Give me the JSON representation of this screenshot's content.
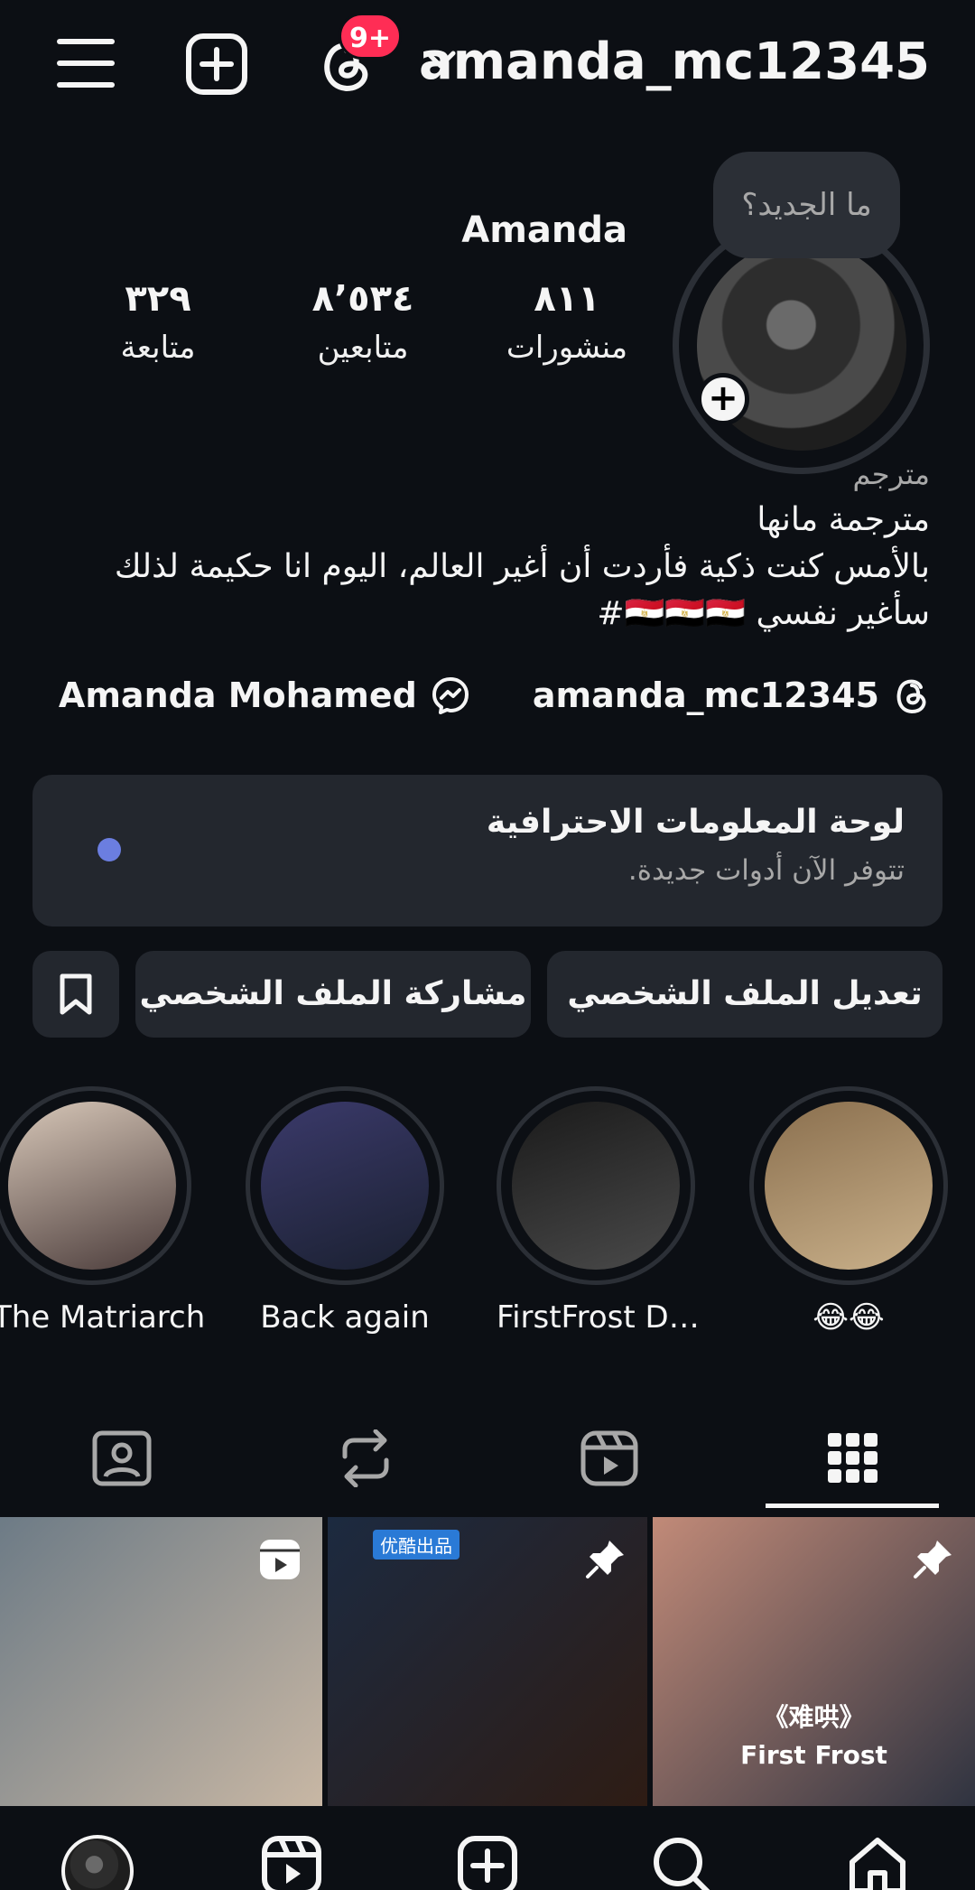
{
  "top_bar": {
    "username": "amanda_mc12345",
    "notification_badge": "9+"
  },
  "profile": {
    "note_bubble": "ما الجديد؟",
    "display_name": "Amanda",
    "stats": {
      "posts_count": "٨١١",
      "posts_label": "منشورات",
      "followers_count": "٨٬٥٣٤",
      "followers_label": "متابعين",
      "following_count": "٣٢٩",
      "following_label": "متابعة"
    },
    "bio": {
      "category": "مترجم",
      "line1": "مترجمة مانها",
      "line2": "بالأمس كنت ذكية فأردت أن أغير العالم، اليوم انا حكيمة لذلك",
      "line3": "سأغير نفسي 🇪🇬🇪🇬🇪🇬#"
    },
    "links": {
      "threads_handle": "amanda_mc12345",
      "messenger_name": "Amanda Mohamed"
    }
  },
  "dashboard": {
    "title": "لوحة المعلومات الاحترافية",
    "subtitle": "تتوفر الآن أدوات جديدة."
  },
  "buttons": {
    "edit_profile": "تعديل الملف الشخصي",
    "share_profile": "مشاركة الملف الشخصي"
  },
  "highlights": [
    {
      "label": "😂😂",
      "colors": [
        "#8a6f4e",
        "#c9b08a"
      ]
    },
    {
      "label": "FirstFrost Dra...",
      "colors": [
        "#1a1a1a",
        "#4a4a4a"
      ]
    },
    {
      "label": "Back again",
      "colors": [
        "#3b3a6b",
        "#1a2030"
      ]
    },
    {
      "label": "The Matriarch",
      "colors": [
        "#d7c7b8",
        "#4a3b3a"
      ]
    }
  ],
  "grid": [
    {
      "type": "reel",
      "colors": [
        "#6d7b86",
        "#c8b7a4"
      ]
    },
    {
      "type": "pinned",
      "tag": "优酷出品",
      "colors": [
        "#1c2a40",
        "#2e1c14"
      ]
    },
    {
      "type": "pinned",
      "caption_top": "《难哄》",
      "caption": "First Frost",
      "colors": [
        "#c18a78",
        "#2f3340"
      ]
    }
  ],
  "colors": {
    "background": "#0c0f14",
    "surface": "#23272e",
    "badge": "#ff2d55",
    "dot": "#6b7ee0"
  }
}
